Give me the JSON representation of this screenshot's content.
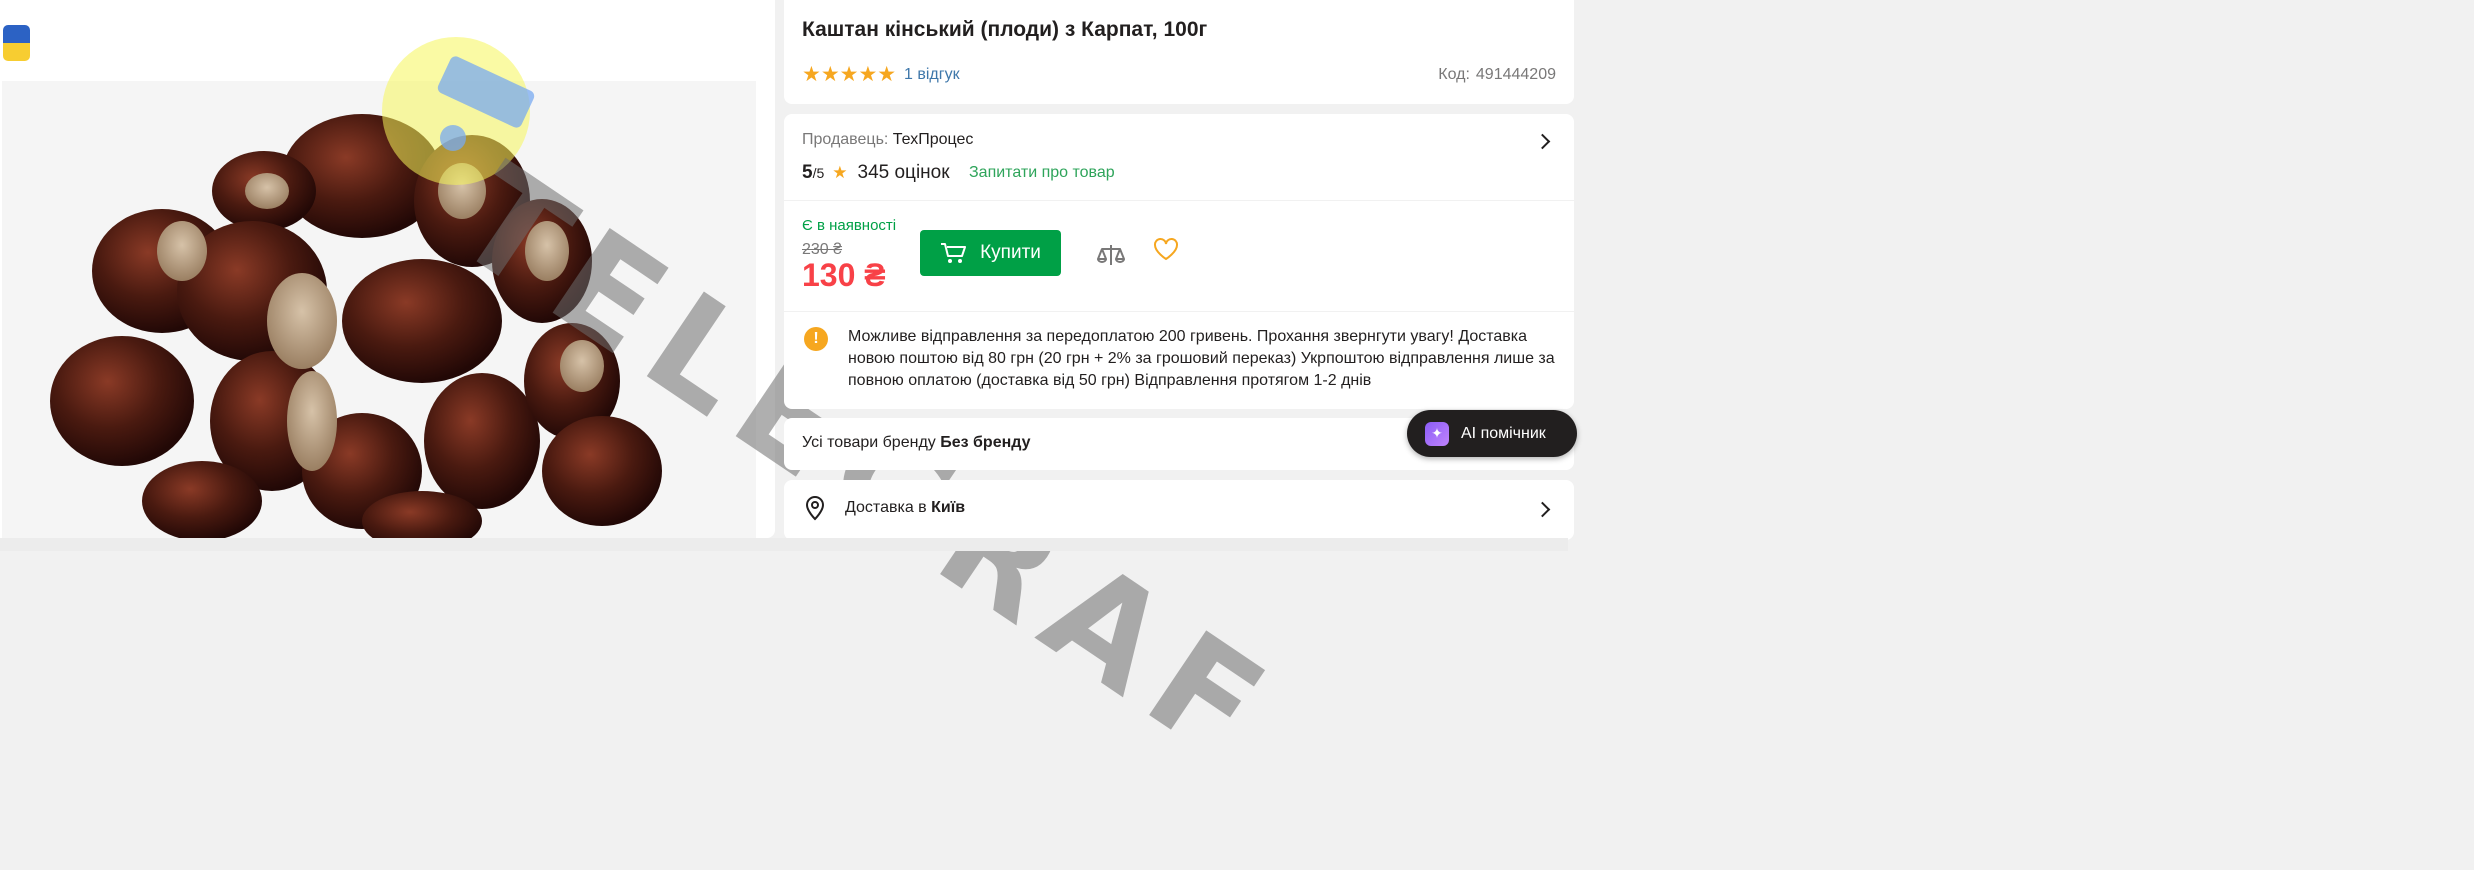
{
  "product": {
    "title": "Каштан кінський (плоди) з Карпат, 100г",
    "stars": "★★★★★",
    "reviews": "1 відгук",
    "code_label": "Код:",
    "code": "491444209"
  },
  "seller": {
    "label": "Продавець:",
    "name": "ТехПроцес",
    "rating_value": "5",
    "rating_max": "/5",
    "rating_count": "345 оцінок",
    "ask": "Запитати про товар"
  },
  "buy": {
    "availability": "Є в наявності",
    "old_price": "230 ₴",
    "price": "130 ₴",
    "button": "Купити"
  },
  "note": "Можливе відправлення за передоплатою 200 гривень. Прохання звернгути увагу! Доставка новою поштою від 80 грн (20 грн + 2% за грошовий переказ) Укрпоштою відправлення лише за повною оплатою (доставка від 50 грн) Відправлення протягом 1-2 днів",
  "brand": {
    "prefix": "Усі товари бренду",
    "name": "Без бренду"
  },
  "delivery": {
    "prefix": "Доставка в",
    "city": "Київ"
  },
  "ai_button": "AI помічник",
  "watermark": "TELEGRAF",
  "icons": [
    "ukraine-flag-icon",
    "star-icon",
    "chevron-right-icon",
    "cart-icon",
    "compare-icon",
    "heart-icon",
    "warning-icon",
    "location-pin-icon",
    "ai-sparkle-icon"
  ],
  "colors": {
    "green": "#00a046",
    "price_red": "#f84147",
    "star": "#f6a720",
    "link_blue": "#3e77aa"
  }
}
